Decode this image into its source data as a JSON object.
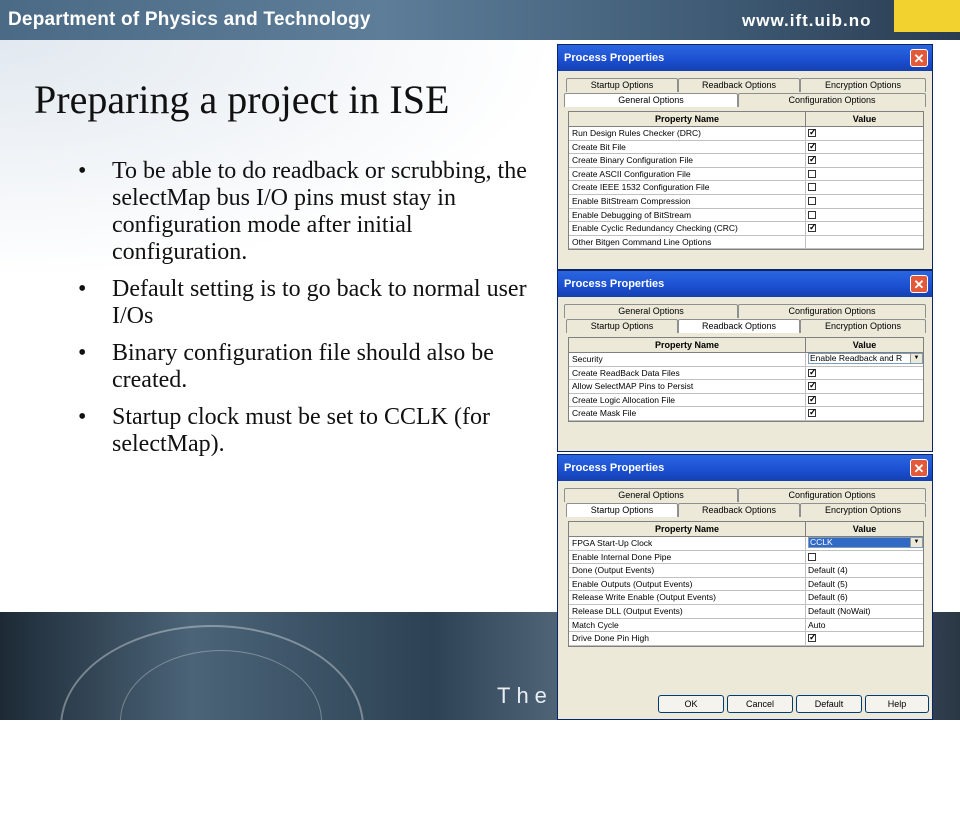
{
  "header": {
    "institution": "Department of Physics and Technology",
    "url": "www.ift.uib.no"
  },
  "slide": {
    "title": "Preparing a project in ISE",
    "bullets": [
      "To be able to do readback or scrubbing, the selectMap bus I/O pins must stay in configuration mode after initial configuration.",
      "Default setting is to go back to normal user I/Os",
      "Binary configuration file should also be created.",
      "Startup clock must be set to CCLK (for selectMap)."
    ]
  },
  "footer": {
    "text": "The U"
  },
  "dialogs": [
    {
      "title": "Process Properties",
      "tabs_back": [
        "Startup Options",
        "Readback Options",
        "Encryption Options"
      ],
      "tabs_front": [
        "General Options",
        "Configuration Options"
      ],
      "active_tab": "General Options",
      "columns": [
        "Property Name",
        "Value"
      ],
      "rows": [
        {
          "name": "Run Design Rules Checker (DRC)",
          "checked": true
        },
        {
          "name": "Create Bit File",
          "checked": true
        },
        {
          "name": "Create Binary Configuration File",
          "checked": true
        },
        {
          "name": "Create ASCII Configuration File",
          "checked": false
        },
        {
          "name": "Create IEEE 1532 Configuration File",
          "checked": false
        },
        {
          "name": "Enable BitStream Compression",
          "checked": false
        },
        {
          "name": "Enable Debugging of BitStream",
          "checked": false
        },
        {
          "name": "Enable Cyclic Redundancy Checking (CRC)",
          "checked": true
        },
        {
          "name": "Other Bitgen Command Line Options",
          "value": ""
        }
      ]
    },
    {
      "title": "Process Properties",
      "tabs_back": [
        "General Options",
        "Configuration Options"
      ],
      "tabs_front": [
        "Startup Options",
        "Readback Options",
        "Encryption Options"
      ],
      "active_tab": "Readback Options",
      "columns": [
        "Property Name",
        "Value"
      ],
      "rows": [
        {
          "name": "Security",
          "value": "Enable Readback and R"
        },
        {
          "name": "Create ReadBack Data Files",
          "checked": true
        },
        {
          "name": "Allow SelectMAP Pins to Persist",
          "checked": true
        },
        {
          "name": "Create Logic Allocation File",
          "checked": true
        },
        {
          "name": "Create Mask File",
          "checked": true
        }
      ]
    },
    {
      "title": "Process Properties",
      "tabs_back": [
        "General Options",
        "Configuration Options"
      ],
      "tabs_front": [
        "Startup Options",
        "Readback Options",
        "Encryption Options"
      ],
      "active_tab": "Startup Options",
      "columns": [
        "Property Name",
        "Value"
      ],
      "rows": [
        {
          "name": "FPGA Start-Up Clock",
          "value": "CCLK"
        },
        {
          "name": "Enable Internal Done Pipe",
          "checked": false
        },
        {
          "name": "Done (Output Events)",
          "value": "Default (4)"
        },
        {
          "name": "Enable Outputs (Output Events)",
          "value": "Default (5)"
        },
        {
          "name": "Release Write Enable (Output Events)",
          "value": "Default (6)"
        },
        {
          "name": "Release DLL (Output Events)",
          "value": "Default (NoWait)"
        },
        {
          "name": "Match Cycle",
          "value": "Auto"
        },
        {
          "name": "Drive Done Pin High",
          "checked": true
        }
      ],
      "buttons": [
        "OK",
        "Cancel",
        "Default",
        "Help"
      ]
    }
  ]
}
